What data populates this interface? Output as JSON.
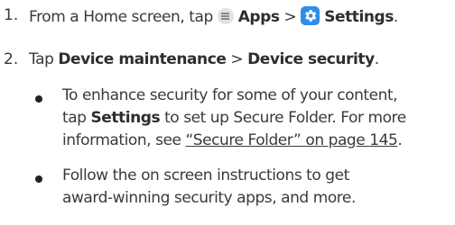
{
  "steps": [
    {
      "number": "1.",
      "prefix": "From a Home screen, tap ",
      "apps_label": "Apps",
      "separator": " > ",
      "settings_label": "Settings",
      "suffix": "."
    },
    {
      "number": "2.",
      "prefix": "Tap ",
      "part1": "Device maintenance",
      "separator": " > ",
      "part2": "Device security",
      "suffix": "."
    }
  ],
  "bullets": [
    {
      "line1": "To enhance security for some of your content,",
      "line2_prefix": "tap ",
      "line2_bold": "Settings",
      "line2_suffix": " to set up Secure Folder. For more",
      "line3_prefix": "information, see ",
      "link": "“Secure Folder” on page 145",
      "line3_suffix": "."
    },
    {
      "line1": "Follow the on screen instructions to get",
      "line2": "award-winning security apps, and more."
    }
  ],
  "icons": {
    "apps": "apps-grid-icon",
    "settings": "settings-gear-icon"
  },
  "colors": {
    "settings_icon_bg": "#2f8ce8",
    "apps_icon_bg": "#e2e2e2",
    "text": "#3a3a3a"
  }
}
